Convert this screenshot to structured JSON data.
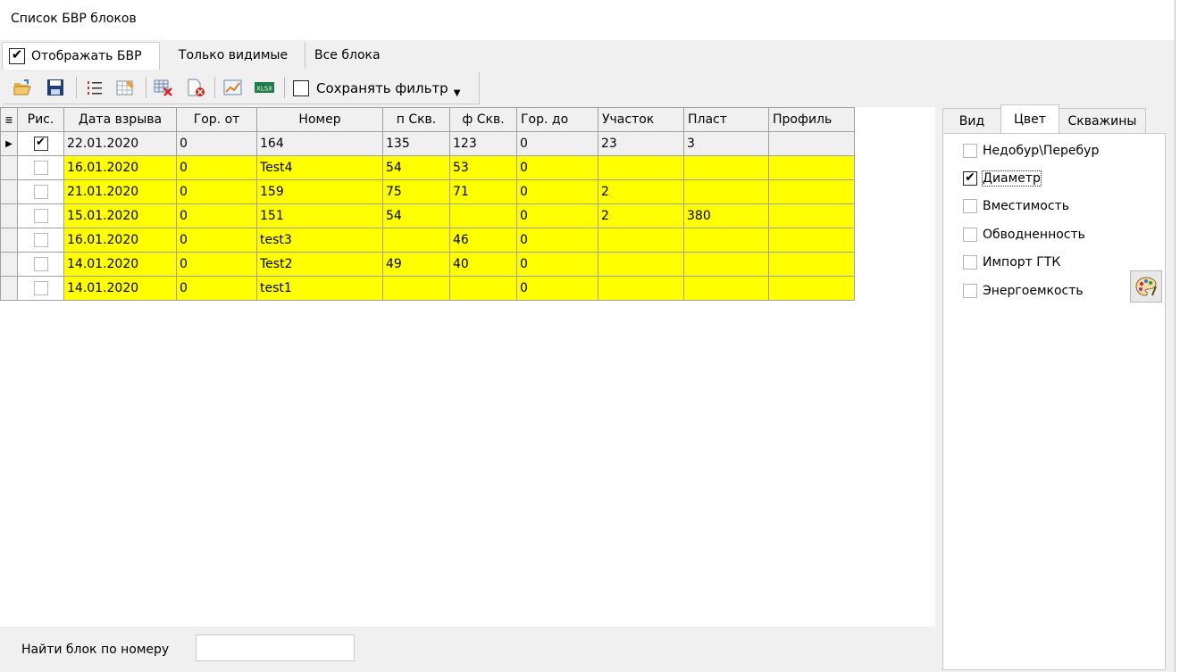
{
  "window": {
    "title": "Список БВР блоков"
  },
  "top_tabs": [
    {
      "label": "Отображать БВР",
      "checked": true
    },
    {
      "label": "Только видимые"
    },
    {
      "label": "Все блока"
    }
  ],
  "toolbar": {
    "icons": [
      "open-folder-icon",
      "save-icon",
      "list-numbered-icon",
      "edit-table-icon",
      "delete-rows-icon",
      "delete-page-icon",
      "chart-icon",
      "export-xlsx-icon"
    ],
    "save_filter_label": "Сохранять фильтр",
    "save_filter_checked": false
  },
  "grid": {
    "columns": [
      "Рис.",
      "Дата взрыва",
      "Гор. от",
      "Номер",
      "п Скв.",
      "ф Скв.",
      "Гор. до",
      "Участок",
      "Пласт",
      "Профиль"
    ],
    "rows": [
      {
        "checked": true,
        "selected": true,
        "date": "22.01.2020",
        "gor_ot": "0",
        "nomer": "164",
        "p_skv": "135",
        "f_skv": "123",
        "gor_do": "0",
        "uchastok": "23",
        "plast": "3",
        "profil": ""
      },
      {
        "checked": false,
        "selected": false,
        "date": "16.01.2020",
        "gor_ot": "0",
        "nomer": "Test4",
        "p_skv": "54",
        "f_skv": "53",
        "gor_do": "0",
        "uchastok": "",
        "plast": "",
        "profil": ""
      },
      {
        "checked": false,
        "selected": false,
        "date": "21.01.2020",
        "gor_ot": "0",
        "nomer": "159",
        "p_skv": "75",
        "f_skv": "71",
        "gor_do": "0",
        "uchastok": "2",
        "plast": "",
        "profil": ""
      },
      {
        "checked": false,
        "selected": false,
        "date": "15.01.2020",
        "gor_ot": "0",
        "nomer": "151",
        "p_skv": "54",
        "f_skv": "",
        "gor_do": "0",
        "uchastok": "2",
        "plast": "380",
        "profil": ""
      },
      {
        "checked": false,
        "selected": false,
        "date": "16.01.2020",
        "gor_ot": "0",
        "nomer": "test3",
        "p_skv": "",
        "f_skv": "46",
        "gor_do": "0",
        "uchastok": "",
        "plast": "",
        "profil": ""
      },
      {
        "checked": false,
        "selected": false,
        "date": "14.01.2020",
        "gor_ot": "0",
        "nomer": "Test2",
        "p_skv": "49",
        "f_skv": "40",
        "gor_do": "0",
        "uchastok": "",
        "plast": "",
        "profil": ""
      },
      {
        "checked": false,
        "selected": false,
        "date": "14.01.2020",
        "gor_ot": "0",
        "nomer": "test1",
        "p_skv": "",
        "f_skv": "",
        "gor_do": "0",
        "uchastok": "",
        "plast": "",
        "profil": ""
      }
    ]
  },
  "search": {
    "label": "Найти блок по номеру",
    "value": ""
  },
  "right_panel": {
    "tabs": [
      {
        "label": "Вид"
      },
      {
        "label": "Цвет",
        "active": true
      },
      {
        "label": "Скважины"
      }
    ],
    "options": [
      {
        "label": "Недобур\\Перебур",
        "checked": false
      },
      {
        "label": "Диаметр",
        "checked": true
      },
      {
        "label": "Вместимость",
        "checked": false
      },
      {
        "label": "Обводненность",
        "checked": false
      },
      {
        "label": "Импорт ГТК",
        "checked": false
      },
      {
        "label": "Энергоемкость",
        "checked": false
      }
    ],
    "palette_icon": "palette-icon"
  },
  "colors": {
    "row_highlight": "#ffff00",
    "selected_row": "#f0f0f0",
    "panel_bg": "#f0f0f0"
  }
}
